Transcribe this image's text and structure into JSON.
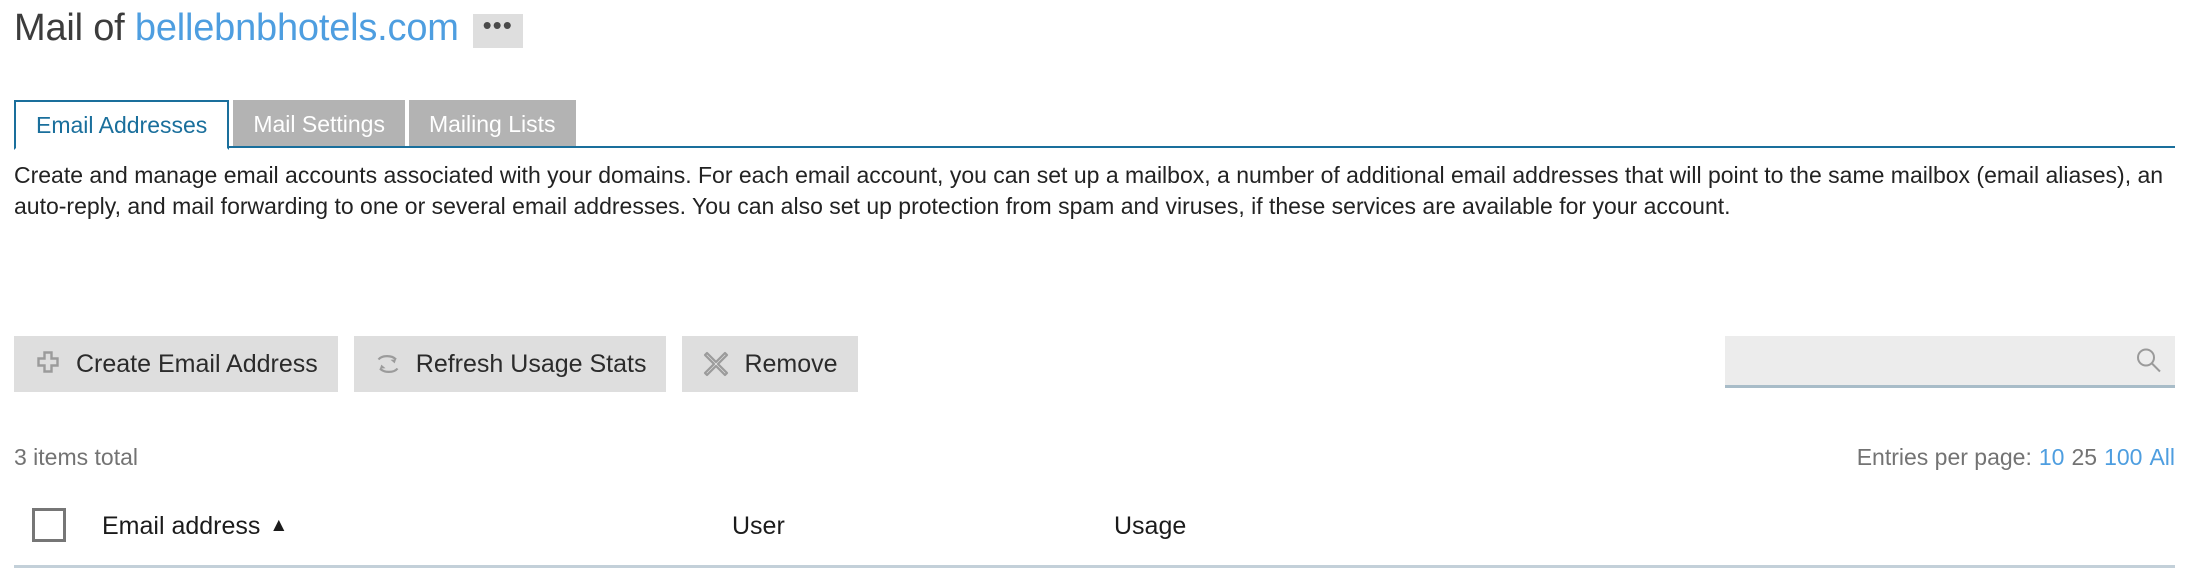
{
  "header": {
    "title_prefix": "Mail of ",
    "domain": "bellebnbhotels.com",
    "more_button_label": "•••",
    "more_button_name": "ellipsis-icon"
  },
  "tabs": [
    {
      "label": "Email Addresses",
      "active": true
    },
    {
      "label": "Mail Settings",
      "active": false
    },
    {
      "label": "Mailing Lists",
      "active": false
    }
  ],
  "description": "Create and manage email accounts associated with your domains. For each email account, you can set up a mailbox, a number of additional email addresses that will point to the same mailbox (email aliases), an auto-reply, and mail forwarding to one or several email addresses. You can also set up protection from spam and viruses, if these services are available for your account.",
  "toolbar": {
    "create_label": "Create Email Address",
    "refresh_label": "Refresh Usage Stats",
    "remove_label": "Remove",
    "create_icon": "plus-icon",
    "refresh_icon": "refresh-icon",
    "remove_icon": "close-x-icon"
  },
  "search": {
    "value": "",
    "placeholder": "",
    "icon": "search-icon"
  },
  "list_info": {
    "items_total": "3 items total",
    "entries_per_page_label": "Entries per page:",
    "entries_options": [
      {
        "label": "10",
        "current": false
      },
      {
        "label": "25",
        "current": true
      },
      {
        "label": "100",
        "current": false
      },
      {
        "label": "All",
        "current": false
      }
    ]
  },
  "table": {
    "columns": [
      {
        "label": "Email address",
        "sorted": true,
        "sort_direction": "asc"
      },
      {
        "label": "User",
        "sorted": false
      },
      {
        "label": "Usage",
        "sorted": false
      }
    ],
    "select_all_checked": false,
    "sort_caret": "▲",
    "rows": []
  },
  "colors": {
    "accent_blue": "#1a6f9c",
    "link_blue": "#4e9ee0",
    "tab_inactive_bg": "#b3b3b3",
    "button_bg": "#dedede",
    "search_bg": "#ececec",
    "muted_text": "#737373",
    "rule": "#c3d0d9"
  }
}
